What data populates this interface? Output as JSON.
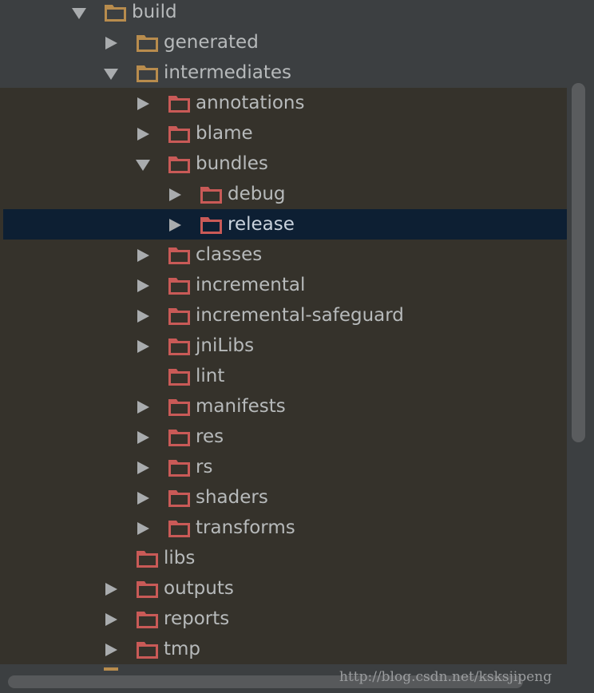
{
  "colors": {
    "folder_gold": "#b88c4d",
    "folder_red": "#c95a57",
    "selection": "#0d1f33",
    "text": "#b7babb"
  },
  "tree": [
    {
      "label": "build",
      "depth": 0,
      "state": "expanded",
      "folder": "gold"
    },
    {
      "label": "generated",
      "depth": 1,
      "state": "collapsed",
      "folder": "gold"
    },
    {
      "label": "intermediates",
      "depth": 1,
      "state": "expanded",
      "folder": "gold"
    },
    {
      "label": "annotations",
      "depth": 2,
      "state": "collapsed",
      "folder": "red"
    },
    {
      "label": "blame",
      "depth": 2,
      "state": "collapsed",
      "folder": "red"
    },
    {
      "label": "bundles",
      "depth": 2,
      "state": "expanded",
      "folder": "red"
    },
    {
      "label": "debug",
      "depth": 3,
      "state": "collapsed",
      "folder": "red"
    },
    {
      "label": "release",
      "depth": 3,
      "state": "collapsed",
      "folder": "red",
      "selected": true
    },
    {
      "label": "classes",
      "depth": 2,
      "state": "collapsed",
      "folder": "red"
    },
    {
      "label": "incremental",
      "depth": 2,
      "state": "collapsed",
      "folder": "red"
    },
    {
      "label": "incremental-safeguard",
      "depth": 2,
      "state": "collapsed",
      "folder": "red"
    },
    {
      "label": "jniLibs",
      "depth": 2,
      "state": "collapsed",
      "folder": "red"
    },
    {
      "label": "lint",
      "depth": 2,
      "state": "leaf",
      "folder": "red"
    },
    {
      "label": "manifests",
      "depth": 2,
      "state": "collapsed",
      "folder": "red"
    },
    {
      "label": "res",
      "depth": 2,
      "state": "collapsed",
      "folder": "red"
    },
    {
      "label": "rs",
      "depth": 2,
      "state": "collapsed",
      "folder": "red"
    },
    {
      "label": "shaders",
      "depth": 2,
      "state": "collapsed",
      "folder": "red"
    },
    {
      "label": "transforms",
      "depth": 2,
      "state": "collapsed",
      "folder": "red"
    },
    {
      "label": "libs",
      "depth": 1,
      "state": "leaf",
      "folder": "red"
    },
    {
      "label": "outputs",
      "depth": 1,
      "state": "collapsed",
      "folder": "red"
    },
    {
      "label": "reports",
      "depth": 1,
      "state": "collapsed",
      "folder": "red"
    },
    {
      "label": "tmp",
      "depth": 1,
      "state": "collapsed",
      "folder": "red"
    }
  ],
  "watermark": "http://blog.csdn.net/ksksjipeng"
}
